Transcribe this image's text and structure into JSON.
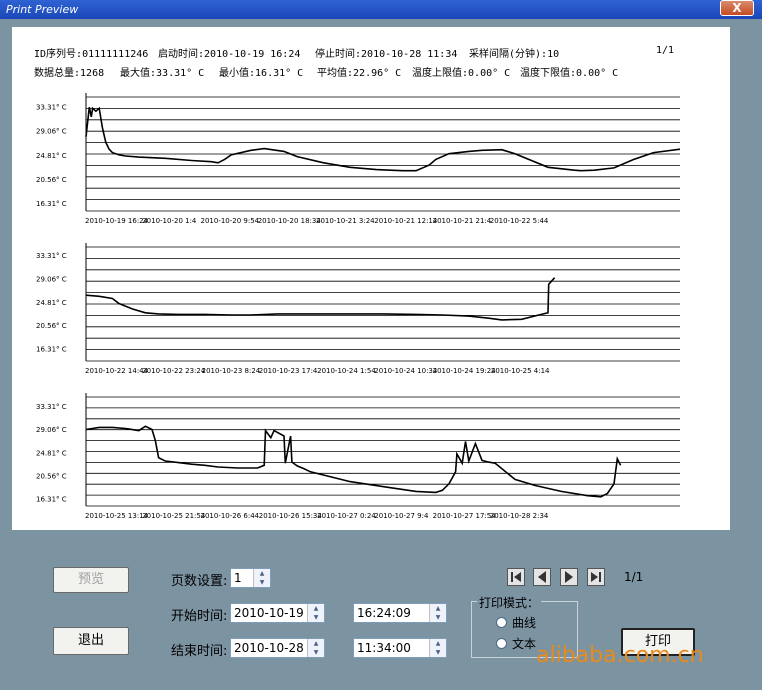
{
  "window": {
    "title": "Print Preview",
    "close_label": "X"
  },
  "report_header": {
    "id_label": "ID序列号:",
    "id_value": "01111111246",
    "start_label": "启动时间:",
    "start_value": "2010-10-19 16:24",
    "stop_label": "停止时间:",
    "stop_value": "2010-10-28 11:34",
    "interval_label": "采样间隔(分钟):",
    "interval_value": "10",
    "page_indicator": "1/1",
    "total_label": "数据总量:",
    "total_value": "1268",
    "max_label": "最大值:",
    "max_value": "33.31° C",
    "min_label": "最小值:",
    "min_value": "16.31° C",
    "avg_label": "平均值:",
    "avg_value": "22.96° C",
    "upper_label": "温度上限值:",
    "upper_value": "0.00° C",
    "lower_label": "温度下限值:",
    "lower_value": "0.00° C"
  },
  "chart_data": [
    {
      "type": "line",
      "y_ticks": [
        "33.31° C",
        "29.06° C",
        "24.81° C",
        "20.56° C",
        "16.31° C"
      ],
      "ylim": [
        14.9,
        35.0
      ],
      "x_tick_labels": [
        "2010-10-19 16:24",
        "2010-10-20 1:4",
        "2010-10-20 9:54",
        "2010-10-20 18:34",
        "2010-10-21 3:24",
        "2010-10-21 12:14",
        "2010-10-21 21:4",
        "2010-10-22 5:44"
      ],
      "x_start": 0,
      "x_end": 90,
      "x_ticks": [
        0,
        8.67,
        17.5,
        26.17,
        35,
        43.83,
        52.67,
        61.33
      ],
      "x": [
        0,
        0.5,
        0.8,
        1.0,
        1.5,
        2,
        2.5,
        3,
        3.5,
        4,
        5,
        6,
        8,
        12,
        16,
        19,
        20,
        21,
        22,
        25,
        27,
        30,
        32,
        36,
        40,
        44,
        48,
        50,
        52,
        53,
        55,
        58,
        60,
        63,
        65,
        70,
        74,
        75,
        77,
        80,
        83,
        86,
        90
      ],
      "y": [
        28.0,
        33.2,
        31.5,
        33.0,
        32.5,
        33.0,
        29.5,
        27.0,
        25.8,
        25.2,
        24.8,
        24.6,
        24.4,
        24.2,
        23.8,
        23.6,
        23.4,
        24.0,
        24.8,
        25.6,
        25.9,
        25.4,
        24.5,
        23.4,
        22.6,
        22.2,
        22.0,
        22.0,
        23.0,
        24.0,
        25.0,
        25.4,
        25.6,
        25.7,
        25.0,
        22.6,
        22.1,
        22.0,
        22.1,
        22.5,
        24.0,
        25.2,
        25.8
      ]
    },
    {
      "type": "line",
      "y_ticks": [
        "33.31° C",
        "29.06° C",
        "24.81° C",
        "20.56° C",
        "16.31° C"
      ],
      "ylim": [
        14.0,
        34.8
      ],
      "x_tick_labels": [
        "2010-10-22 14:44",
        "2010-10-22 23:24",
        "2010-10-23 8:24",
        "2010-10-23 17:4",
        "2010-10-24 1:54",
        "2010-10-24 10:34",
        "2010-10-24 19:24",
        "2010-10-25 4:14"
      ],
      "x_start": 90,
      "x_end": 180,
      "x_ticks": [
        90,
        98.67,
        107.67,
        116.33,
        125.17,
        133.83,
        142.67,
        151.5
      ],
      "x": [
        90,
        92,
        94,
        95,
        97,
        99,
        101,
        104,
        108,
        112,
        115,
        119,
        124,
        130,
        135,
        140,
        144,
        148,
        151,
        153,
        156,
        159,
        160,
        160.1,
        161
      ],
      "y": [
        26.0,
        25.8,
        25.4,
        24.5,
        23.5,
        22.8,
        22.6,
        22.5,
        22.5,
        22.4,
        22.4,
        22.6,
        22.6,
        22.6,
        22.6,
        22.5,
        22.4,
        22.2,
        21.8,
        21.5,
        21.6,
        22.5,
        22.8,
        28.0,
        29.2
      ]
    },
    {
      "type": "line",
      "y_ticks": [
        "33.31° C",
        "29.06° C",
        "24.81° C",
        "20.56° C",
        "16.31° C"
      ],
      "ylim": [
        14.9,
        35.0
      ],
      "x_tick_labels": [
        "2010-10-25 13:14",
        "2010-10-25 21:54",
        "2010-10-26 6:44",
        "2010-10-26 15:34",
        "2010-10-27 0:24",
        "2010-10-27 9:4",
        "2010-10-27 17:54",
        "2010-10-28 2:34"
      ],
      "x_start": 180,
      "x_end": 270,
      "x_ticks": [
        180,
        188.67,
        197.5,
        206.33,
        215.17,
        223.83,
        232.67,
        241.33
      ],
      "x": [
        180,
        182,
        184,
        186,
        188,
        189,
        190,
        190.5,
        191,
        192,
        194,
        196,
        198,
        200,
        203,
        206,
        207,
        207.2,
        208,
        208.5,
        210,
        210.2,
        211,
        211.2,
        212,
        213,
        214,
        220,
        226,
        230,
        233,
        234,
        235,
        236,
        236.2,
        237,
        237.5,
        238,
        239,
        240,
        241,
        242,
        245,
        248,
        252,
        256,
        258,
        259,
        260,
        260.5,
        261
      ],
      "y": [
        29.0,
        29.4,
        29.4,
        29.2,
        28.8,
        29.6,
        29.0,
        27.0,
        23.8,
        23.2,
        22.9,
        22.6,
        22.4,
        22.1,
        21.9,
        21.9,
        22.4,
        28.8,
        27.5,
        28.8,
        27.8,
        22.8,
        27.8,
        23.0,
        22.3,
        21.8,
        21.2,
        19.4,
        18.3,
        17.6,
        17.4,
        17.8,
        19.0,
        21.2,
        24.5,
        22.8,
        26.8,
        23.2,
        26.4,
        23.3,
        23.0,
        22.8,
        19.8,
        18.7,
        17.6,
        16.8,
        16.6,
        17.2,
        19.0,
        23.6,
        22.4
      ]
    }
  ],
  "controls": {
    "preview_label": "预览",
    "exit_label": "退出",
    "pages_label": "页数设置:",
    "pages_value": "1",
    "start_time_label": "开始时间:",
    "start_date": "2010-10-19",
    "start_time": "16:24:09",
    "end_time_label": "结束时间:",
    "end_date": "2010-10-28",
    "end_time": "11:34:00",
    "page_indicator": "1/1",
    "print_mode_label": "打印模式：",
    "mode_curve": "曲线",
    "mode_text": "文本",
    "print_label": "打印"
  },
  "watermark": "alibaba.com.cn",
  "colors": {
    "background": "#7c93a1",
    "titlebar": "#2357c8",
    "close_button": "#c9502a",
    "watermark": "#e98a1c"
  }
}
